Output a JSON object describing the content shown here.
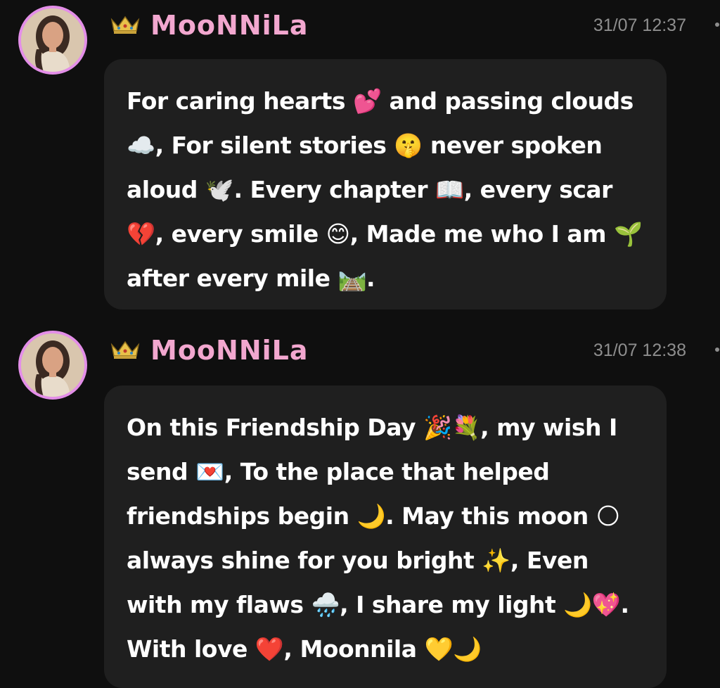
{
  "messages": [
    {
      "username": "MooNNiLa",
      "timestamp": "31/07 12:37",
      "text": "For caring hearts 💕 and passing clouds ☁️, For silent stories 🤫 never spoken aloud 🕊️. Every chapter 📖, every scar 💔, every smile 😊, Made me who I am 🌱 after every mile 🛤️."
    },
    {
      "username": "MooNNiLa",
      "timestamp": "31/07 12:38",
      "text": "On this Friendship Day 🎉💐, my wish I send 💌, To the place that helped friendships begin 🌙. May this moon 🌕 always shine for you bright ✨, Even with my flaws 🌧️, I share my light 🌙💖. With love ❤️, Moonnila 💛🌙"
    }
  ],
  "icons": {
    "badge": "crown-icon",
    "menu": "more-options-icon"
  },
  "colors": {
    "background": "#0f0f0f",
    "bubble": "#1f1f1f",
    "username": "#f2a7cf",
    "avatar_ring": "#e38ee8",
    "timestamp": "#8e8e8e"
  }
}
